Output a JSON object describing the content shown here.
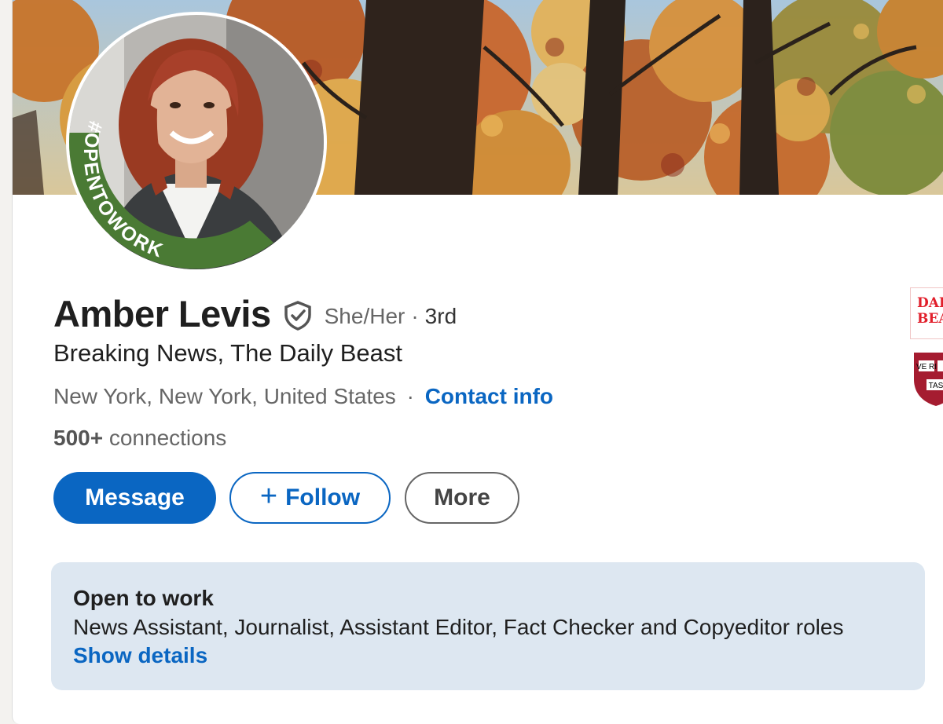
{
  "profile": {
    "name": "Amber Levis",
    "pronouns": "She/Her",
    "separator": "·",
    "degree": "3rd",
    "headline": "Breaking News, The Daily Beast",
    "location": "New York, New York, United States",
    "contact_info": "Contact info",
    "connections_count": "500+",
    "connections_label": "connections",
    "open_to_work_badge": "#OPENTOWORK"
  },
  "actions": {
    "message_label": "Message",
    "follow_plus": "+",
    "follow_label": "Follow",
    "more_label": "More"
  },
  "open_to_work": {
    "title": "Open to work",
    "roles": "News Assistant, Journalist, Assistant Editor, Fact Checker and Copyeditor roles",
    "show_details": "Show details"
  },
  "sidebar_logos": {
    "company_line1": "DAIL",
    "company_line2": "BEAS",
    "school_shield_line1": "VE RI",
    "school_shield_line2": "TAS"
  },
  "colors": {
    "accent_blue": "#0a66c2",
    "open_to_work_green": "#4a7a34",
    "open_to_work_card": "#dde7f1"
  }
}
